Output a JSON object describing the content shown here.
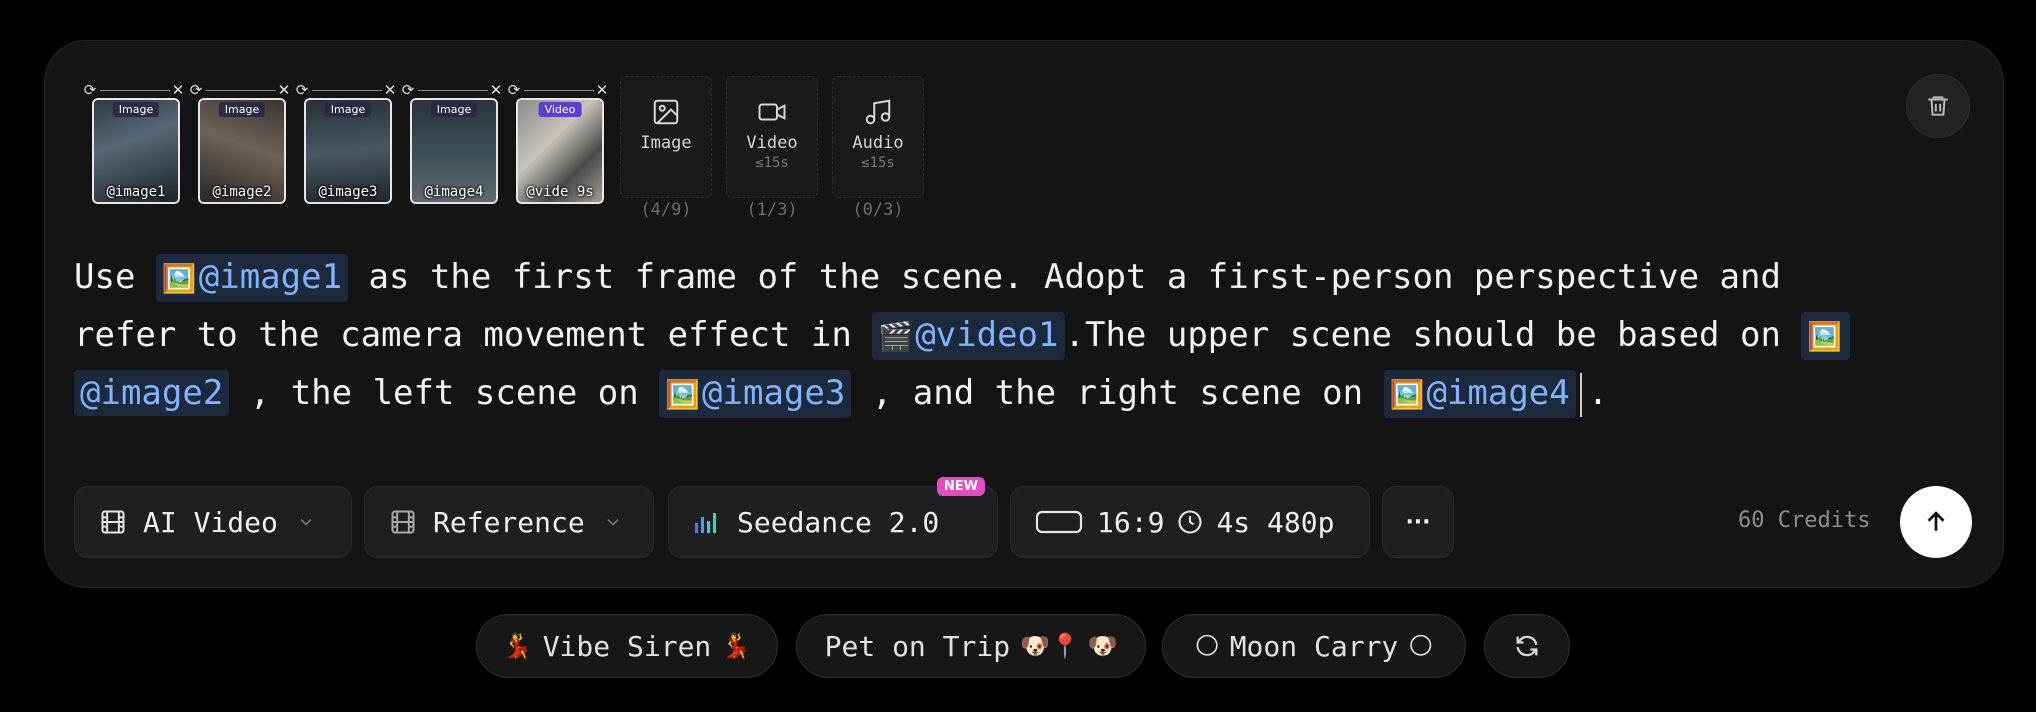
{
  "attachments": [
    {
      "tag": "Image",
      "caption": "@image1"
    },
    {
      "tag": "Image",
      "caption": "@image2"
    },
    {
      "tag": "Image",
      "caption": "@image3"
    },
    {
      "tag": "Image",
      "caption": "@image4"
    },
    {
      "tag": "Video",
      "caption": "@vide",
      "duration": "9s"
    }
  ],
  "uploads": [
    {
      "label": "Image",
      "sub": "",
      "count": "(4/9)"
    },
    {
      "label": "Video",
      "sub": "≤15s",
      "count": "(1/3)"
    },
    {
      "label": "Audio",
      "sub": "≤15s",
      "count": "(0/3)"
    }
  ],
  "prompt": {
    "t1": "Use ",
    "r1": "@image1",
    "t2": " as the first frame of the scene. Adopt a first-person perspective and",
    "t3": "refer to the camera movement effect in ",
    "r2": "@video1",
    "t4": ".The upper scene should be based on ",
    "r3": "@image2",
    "t5": " , the left scene on ",
    "r4": "@image3",
    "t6": " , and the right scene on ",
    "r5": "@image4",
    "t7": ".",
    "image_emoji": "🖼️",
    "video_emoji": "🎬"
  },
  "toolbar": {
    "mode": "AI Video",
    "reference": "Reference",
    "model": "Seedance 2.0",
    "model_badge": "NEW",
    "aspect": "16:9",
    "duration_res": "4s 480p",
    "more": "···",
    "credits": "60 Credits"
  },
  "suggestions": [
    {
      "pre": "💃",
      "label": "Vibe Siren",
      "post": "💃"
    },
    {
      "pre": "",
      "label": "Pet on Trip",
      "post": "🐶📍 🐶"
    },
    {
      "pre": "🌕",
      "label": "Moon Carry",
      "post": "🌕"
    }
  ],
  "colors": {
    "accent_ref": "#7fb4ff",
    "badge": "#e24cc4",
    "video_tag": "#5a3fd0"
  }
}
